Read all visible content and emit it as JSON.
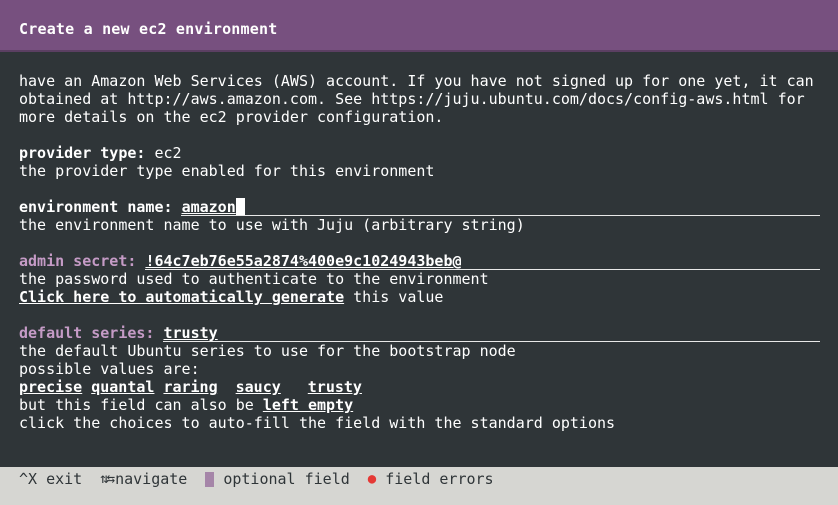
{
  "window": {
    "title": "Create a new ec2 environment"
  },
  "intro": {
    "lines": [
      "have an Amazon Web Services (AWS) account. If you have not signed up for one yet, it can",
      "obtained at http://aws.amazon.com. See https://juju.ubuntu.com/docs/config-aws.html for",
      "more details on the ec2 provider configuration."
    ]
  },
  "provider": {
    "label": "provider type:",
    "value": "ec2",
    "help": "the provider type enabled for this environment"
  },
  "env_name": {
    "label": "environment name:",
    "value": "amazon",
    "help": "the environment name to use with Juju (arbitrary string)"
  },
  "admin_secret": {
    "label": "admin secret:",
    "value": "!64c7eb76e55a2874%400e9c1024943beb@",
    "help": "the password used to authenticate to the environment",
    "generate_link": "Click here to automatically generate",
    "generate_suffix": "this value"
  },
  "default_series": {
    "label": "default series:",
    "value": "trusty",
    "help": "the default Ubuntu series to use for the bootstrap node",
    "possible_label": "possible values are:",
    "options": [
      "precise",
      "quantal",
      "raring",
      "saucy",
      "trusty"
    ],
    "empty_prefix": "but this field can also be",
    "empty_link": "left empty",
    "autofill_help": "click the choices to auto-fill the field with the standard options"
  },
  "statusbar": {
    "exit": "^X exit",
    "navigate": "navigate",
    "optional": "optional field",
    "errors": "field errors"
  },
  "colors": {
    "title_bg": "#77507f",
    "body_bg": "#2f3538",
    "optional_label": "#c59bc6",
    "statusbar_bg": "#d6d6d2",
    "error_dot": "#e53935"
  }
}
